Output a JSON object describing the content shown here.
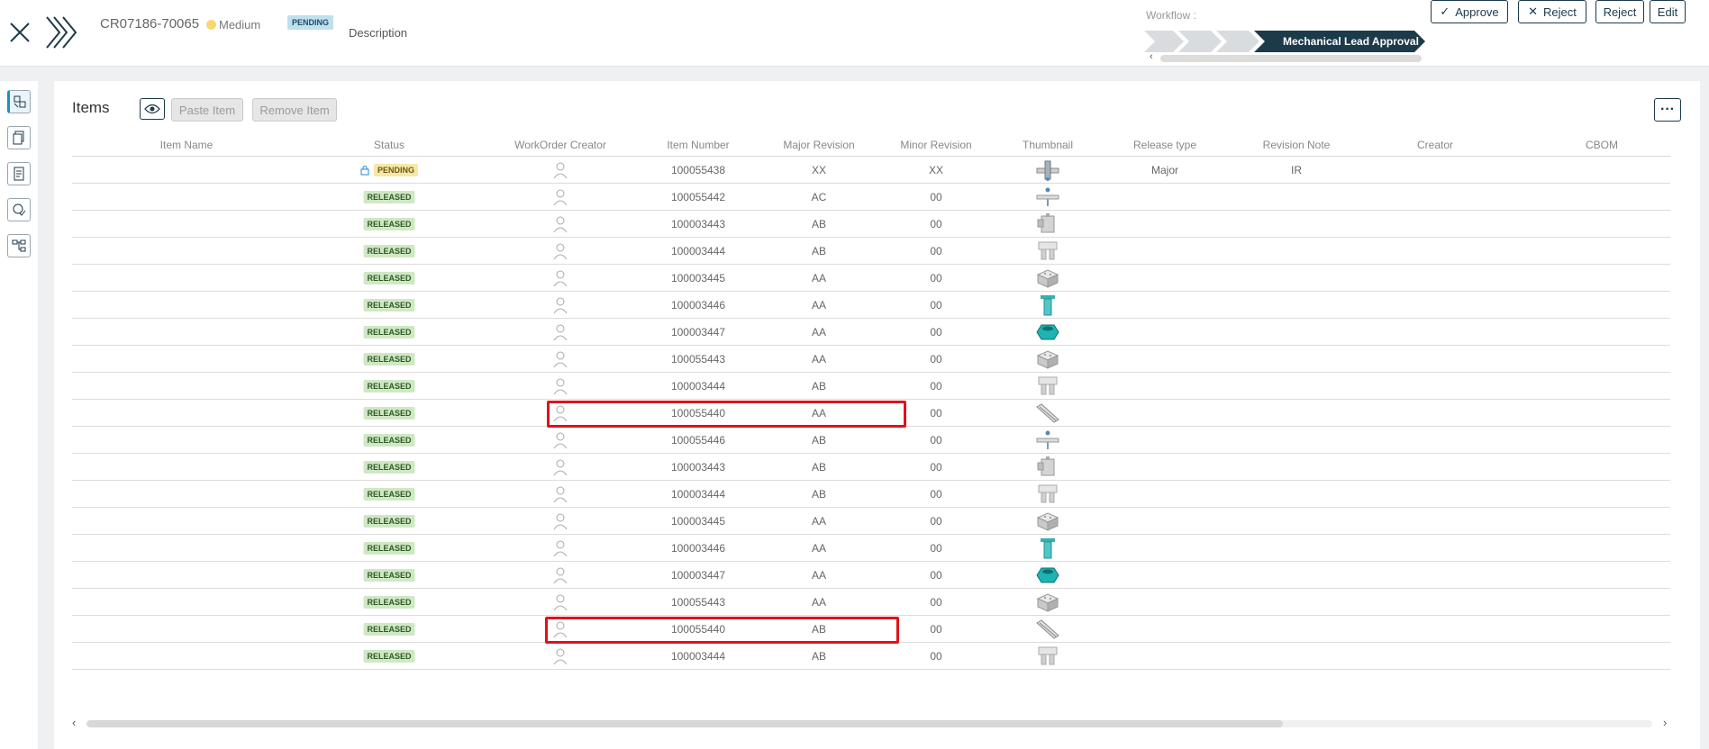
{
  "header": {
    "cr_id": "CR07186-70065",
    "priority": "Medium",
    "status_badge": "PENDING",
    "description_label": "Description",
    "workflow_label": "Workflow :",
    "workflow_current_step": "Mechanical Lead Approval",
    "buttons": {
      "approve": "Approve",
      "reject_x": "Reject",
      "reject": "Reject",
      "edit": "Edit"
    }
  },
  "items": {
    "title": "Items",
    "paste_label": "Paste Item",
    "remove_label": "Remove Item"
  },
  "columns": [
    "Item Name",
    "Status",
    "WorkOrder Creator",
    "Item Number",
    "Major Revision",
    "Minor Revision",
    "Thumbnail",
    "Release type",
    "Revision Note",
    "Creator",
    "CBOM"
  ],
  "rows": [
    {
      "status": "PENDING",
      "item_number": "100055438",
      "major": "XX",
      "minor": "XX",
      "thumb": "cross-rail",
      "release_type": "Major",
      "revision_note": "IR"
    },
    {
      "status": "RELEASED",
      "item_number": "100055442",
      "major": "AC",
      "minor": "00",
      "thumb": "rail-assembly",
      "release_type": "",
      "revision_note": ""
    },
    {
      "status": "RELEASED",
      "item_number": "100003443",
      "major": "AB",
      "minor": "00",
      "thumb": "clamp",
      "release_type": "",
      "revision_note": ""
    },
    {
      "status": "RELEASED",
      "item_number": "100003444",
      "major": "AB",
      "minor": "00",
      "thumb": "bracket",
      "release_type": "",
      "revision_note": ""
    },
    {
      "status": "RELEASED",
      "item_number": "100003445",
      "major": "AA",
      "minor": "00",
      "thumb": "block",
      "release_type": "",
      "revision_note": ""
    },
    {
      "status": "RELEASED",
      "item_number": "100003446",
      "major": "AA",
      "minor": "00",
      "thumb": "pin",
      "release_type": "",
      "revision_note": ""
    },
    {
      "status": "RELEASED",
      "item_number": "100003447",
      "major": "AA",
      "minor": "00",
      "thumb": "hex-nut",
      "release_type": "",
      "revision_note": ""
    },
    {
      "status": "RELEASED",
      "item_number": "100055443",
      "major": "AA",
      "minor": "00",
      "thumb": "block",
      "release_type": "",
      "revision_note": ""
    },
    {
      "status": "RELEASED",
      "item_number": "100003444",
      "major": "AB",
      "minor": "00",
      "thumb": "bracket",
      "release_type": "",
      "revision_note": ""
    },
    {
      "status": "RELEASED",
      "item_number": "100055440",
      "major": "AA",
      "minor": "00",
      "thumb": "rail",
      "release_type": "",
      "revision_note": ""
    },
    {
      "status": "RELEASED",
      "item_number": "100055446",
      "major": "AB",
      "minor": "00",
      "thumb": "rail-assembly",
      "release_type": "",
      "revision_note": ""
    },
    {
      "status": "RELEASED",
      "item_number": "100003443",
      "major": "AB",
      "minor": "00",
      "thumb": "clamp",
      "release_type": "",
      "revision_note": ""
    },
    {
      "status": "RELEASED",
      "item_number": "100003444",
      "major": "AB",
      "minor": "00",
      "thumb": "bracket",
      "release_type": "",
      "revision_note": ""
    },
    {
      "status": "RELEASED",
      "item_number": "100003445",
      "major": "AA",
      "minor": "00",
      "thumb": "block",
      "release_type": "",
      "revision_note": ""
    },
    {
      "status": "RELEASED",
      "item_number": "100003446",
      "major": "AA",
      "minor": "00",
      "thumb": "pin",
      "release_type": "",
      "revision_note": ""
    },
    {
      "status": "RELEASED",
      "item_number": "100003447",
      "major": "AA",
      "minor": "00",
      "thumb": "hex-nut",
      "release_type": "",
      "revision_note": ""
    },
    {
      "status": "RELEASED",
      "item_number": "100055443",
      "major": "AA",
      "minor": "00",
      "thumb": "block",
      "release_type": "",
      "revision_note": ""
    },
    {
      "status": "RELEASED",
      "item_number": "100055440",
      "major": "AB",
      "minor": "00",
      "thumb": "rail",
      "release_type": "",
      "revision_note": ""
    },
    {
      "status": "RELEASED",
      "item_number": "100003444",
      "major": "AB",
      "minor": "00",
      "thumb": "bracket",
      "release_type": "",
      "revision_note": ""
    }
  ],
  "highlighted_rows": [
    9,
    17
  ],
  "colors": {
    "accent": "#1d3a4a",
    "released_bg": "#cfe8c4",
    "pending_bg": "#f7e7a8",
    "highlight": "#e0121b",
    "workflow_active": "#1d3a4a"
  },
  "rail_icons": [
    "items-icon",
    "documents-icon",
    "report-icon",
    "approval-icon",
    "hierarchy-icon"
  ]
}
